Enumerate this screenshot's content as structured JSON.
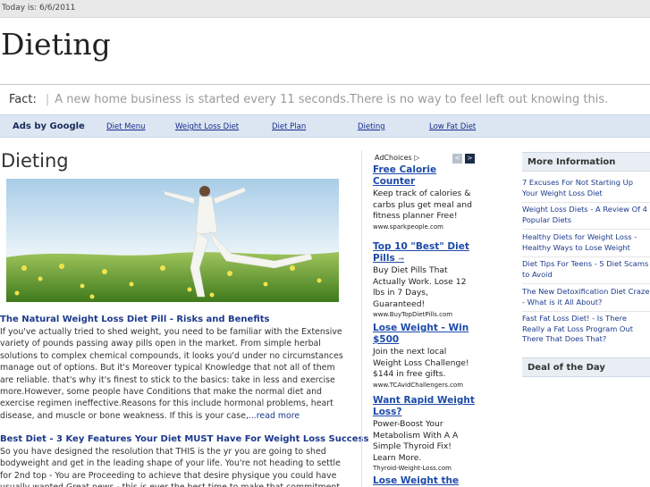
{
  "top_bar": {
    "today": "Today is: 6/6/2011"
  },
  "site": {
    "title": "Dieting"
  },
  "fact": {
    "label": "Fact:",
    "separator": "|",
    "text": "A new home business is started every 11 seconds.There is no way to feel left out knowing this."
  },
  "nav": {
    "ads_label": "Ads by Google",
    "links": [
      "Diet Menu",
      "Weight Loss Diet",
      "Diet Plan",
      "Dieting",
      "Low Fat Diet"
    ]
  },
  "main": {
    "title": "Dieting",
    "articles": [
      {
        "title": "The Natural Weight Loss Diet Pill - Risks and Benefits",
        "body": "If you've actually tried to shed weight, you need to be familiar with the Extensive variety of pounds passing away pills open in the market. From simple herbal solutions to complex chemical compounds, it looks you'd under no circumstances manage out of options. But it's Moreover typical Knowledge that not all of them are reliable. that's why it's finest to stick to the basics: take in less and exercise more.However, some people have Conditions that make the normal diet and exercise regimen ineffective.Reasons for this include hormonal problems, heart disease, and muscle or bone weakness. If this is your case,",
        "more": "...read more"
      },
      {
        "title": "Best Diet - 3 Key Features Your Diet MUST Have For Weight Loss Success",
        "body": "So you have designed the resolution that THIS is the yr you are going to shed bodyweight and get in the leading shape of your life. You're not heading to settle for 2nd top - You are Proceeding to achieve that desire physique you could have usually wanted Great news - this is ever the best time to make that commitment"
      }
    ]
  },
  "ads": {
    "adchoices": "AdChoices",
    "prev": "<",
    "next": ">",
    "items": [
      {
        "headline": "Free Calorie Counter",
        "body": "Keep track of calories & carbs plus get meal and fitness planner Free!",
        "url": "www.sparkpeople.com"
      },
      {
        "headline": "Top 10 \"Best\" Diet Pills",
        "body": "Buy Diet Pills That Actually Work. Lose 12 lbs in 7 Days, Guaranteed!",
        "url": "www.BuyTopDietPills.com"
      },
      {
        "headline": "Lose Weight - Win $500",
        "body": "Join the next local Weight Loss Challenge! $144 in free gifts.",
        "url": "www.TCAvidChallengers.com"
      },
      {
        "headline": "Want Rapid Weight Loss?",
        "body": "Power-Boost Your Metabolism With A A Simple Thyroid Fix! Learn More.",
        "url": "Thyroid-Weight-Loss.com"
      },
      {
        "headline": "Lose Weight the",
        "body": "",
        "url": ""
      }
    ]
  },
  "sidebar": {
    "more_info_title": "More Information",
    "links": [
      "7 Excuses For Not Starting Up Your Weight Loss Diet",
      "Weight Loss Diets - A Review Of 4 Popular Diets",
      "Healthy Diets for Weight Loss - Healthy Ways to Lose Weight",
      "Diet Tips For Teens - 5 Diet Scams to Avoid",
      "The New Detoxification Diet Craze - What is it All About?",
      "Fast Fat Loss Diet! - Is There Really a Fat Loss Program Out There That Does That?"
    ],
    "deal_title": "Deal of the Day"
  }
}
